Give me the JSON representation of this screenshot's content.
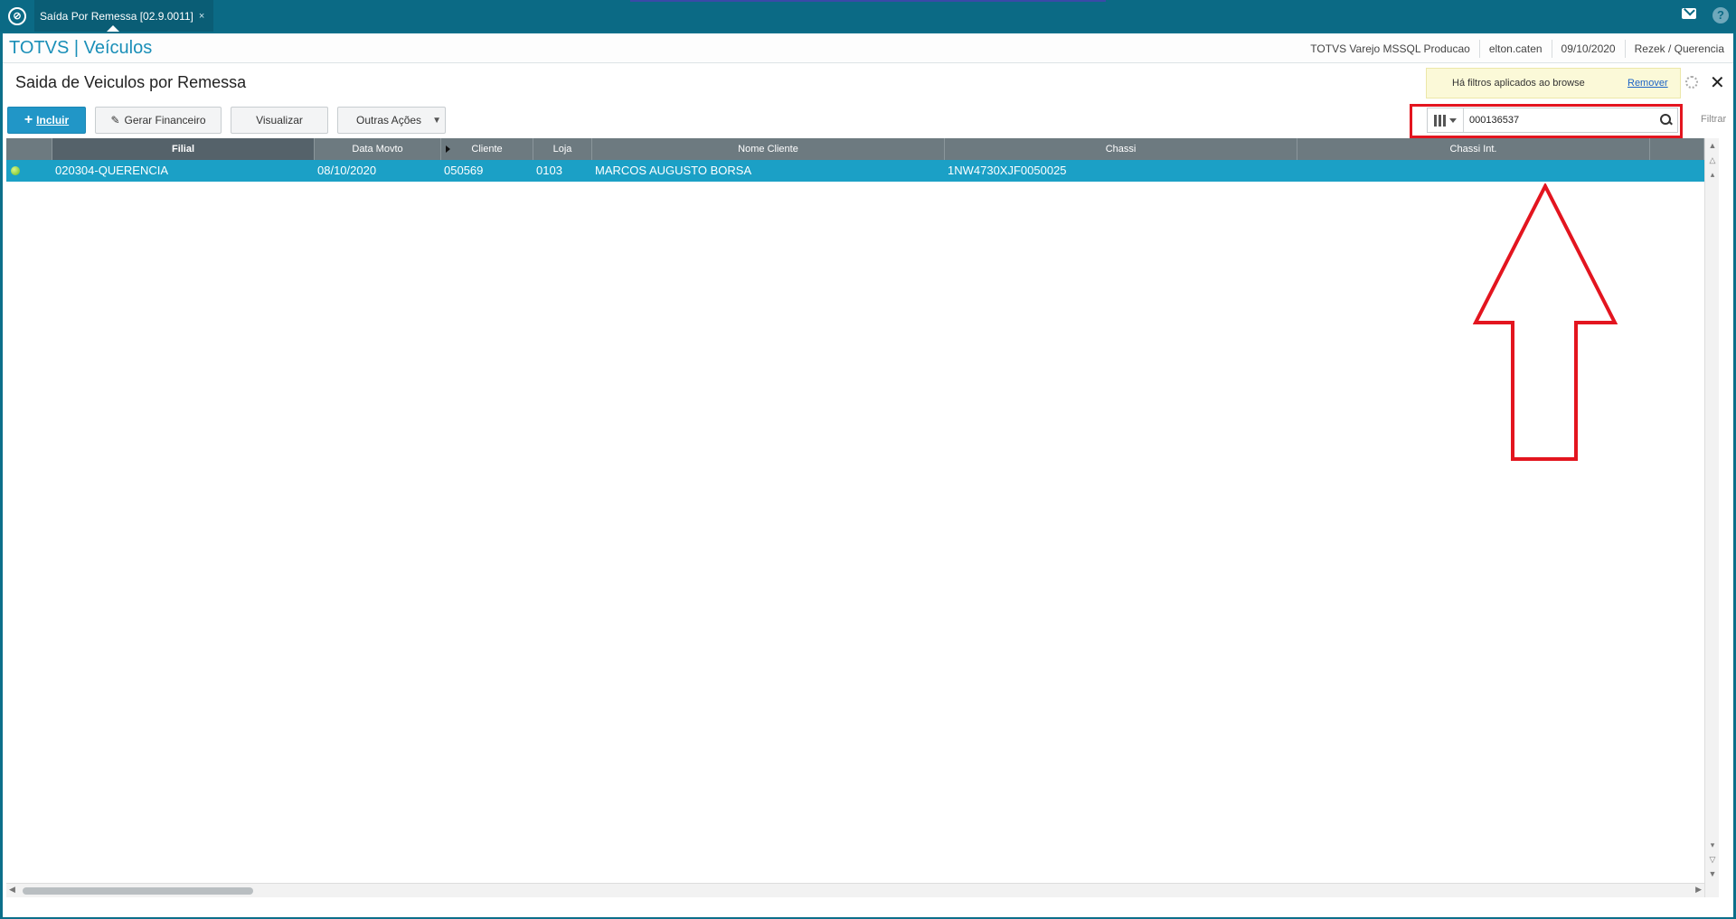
{
  "window": {
    "tab_title": "Saída Por Remessa [02.9.0011]",
    "tab_close": "×",
    "logo_glyph": "⊘"
  },
  "brand": {
    "title": "TOTVS | Veículos",
    "environment": "TOTVS Varejo MSSQL Producao",
    "user": "elton.caten",
    "date": "09/10/2020",
    "company": "Rezek / Querencia"
  },
  "page": {
    "title": "Saida de Veiculos por Remessa"
  },
  "filter_notice": {
    "message": "Há filtros aplicados ao browse",
    "remove_label": "Remover"
  },
  "toolbar": {
    "incluir_label": "Incluir",
    "gerar_label": "Gerar Financeiro",
    "visualizar_label": "Visualizar",
    "outras_label": "Outras Ações"
  },
  "search": {
    "value": "000136537",
    "filter_label": "Filtrar"
  },
  "grid": {
    "columns": [
      "",
      "Filial",
      "Data Movto",
      "Cliente",
      "Loja",
      "Nome Cliente",
      "Chassi",
      "Chassi Int."
    ],
    "sorted_column": "Filial",
    "rows": [
      {
        "status": "green",
        "filial": "020304-QUERENCIA",
        "data_movto": "08/10/2020",
        "cliente": "050569",
        "loja": "0103",
        "nome_cliente": "MARCOS AUGUSTO BORSA",
        "chassi": "1NW4730XJF0050025",
        "chassi_int": ""
      }
    ]
  },
  "colors": {
    "accent": "#2196c7",
    "selected_row": "#1ba0c6",
    "header": "#6d7a80",
    "annotation": "#e3151f"
  }
}
